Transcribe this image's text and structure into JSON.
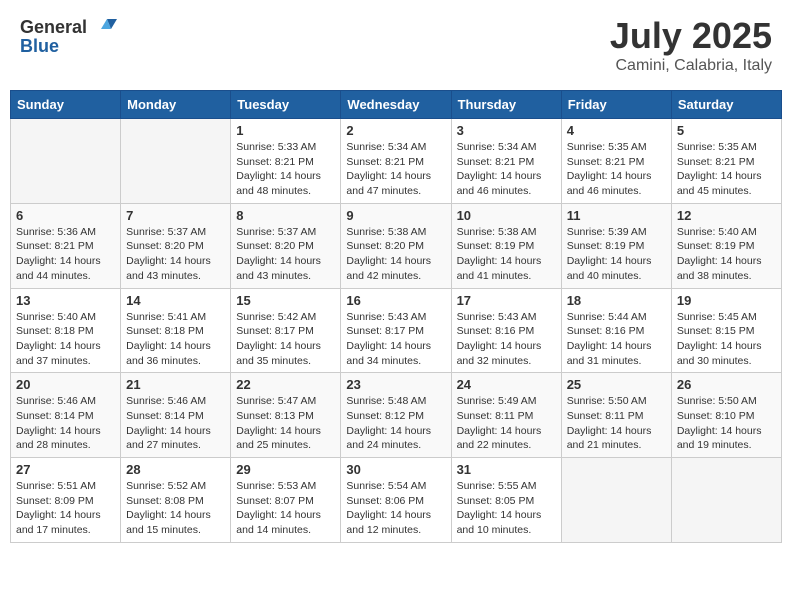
{
  "header": {
    "logo_general": "General",
    "logo_blue": "Blue",
    "month": "July 2025",
    "location": "Camini, Calabria, Italy"
  },
  "weekdays": [
    "Sunday",
    "Monday",
    "Tuesday",
    "Wednesday",
    "Thursday",
    "Friday",
    "Saturday"
  ],
  "weeks": [
    [
      {
        "day": "",
        "info": ""
      },
      {
        "day": "",
        "info": ""
      },
      {
        "day": "1",
        "info": "Sunrise: 5:33 AM\nSunset: 8:21 PM\nDaylight: 14 hours\nand 48 minutes."
      },
      {
        "day": "2",
        "info": "Sunrise: 5:34 AM\nSunset: 8:21 PM\nDaylight: 14 hours\nand 47 minutes."
      },
      {
        "day": "3",
        "info": "Sunrise: 5:34 AM\nSunset: 8:21 PM\nDaylight: 14 hours\nand 46 minutes."
      },
      {
        "day": "4",
        "info": "Sunrise: 5:35 AM\nSunset: 8:21 PM\nDaylight: 14 hours\nand 46 minutes."
      },
      {
        "day": "5",
        "info": "Sunrise: 5:35 AM\nSunset: 8:21 PM\nDaylight: 14 hours\nand 45 minutes."
      }
    ],
    [
      {
        "day": "6",
        "info": "Sunrise: 5:36 AM\nSunset: 8:21 PM\nDaylight: 14 hours\nand 44 minutes."
      },
      {
        "day": "7",
        "info": "Sunrise: 5:37 AM\nSunset: 8:20 PM\nDaylight: 14 hours\nand 43 minutes."
      },
      {
        "day": "8",
        "info": "Sunrise: 5:37 AM\nSunset: 8:20 PM\nDaylight: 14 hours\nand 43 minutes."
      },
      {
        "day": "9",
        "info": "Sunrise: 5:38 AM\nSunset: 8:20 PM\nDaylight: 14 hours\nand 42 minutes."
      },
      {
        "day": "10",
        "info": "Sunrise: 5:38 AM\nSunset: 8:19 PM\nDaylight: 14 hours\nand 41 minutes."
      },
      {
        "day": "11",
        "info": "Sunrise: 5:39 AM\nSunset: 8:19 PM\nDaylight: 14 hours\nand 40 minutes."
      },
      {
        "day": "12",
        "info": "Sunrise: 5:40 AM\nSunset: 8:19 PM\nDaylight: 14 hours\nand 38 minutes."
      }
    ],
    [
      {
        "day": "13",
        "info": "Sunrise: 5:40 AM\nSunset: 8:18 PM\nDaylight: 14 hours\nand 37 minutes."
      },
      {
        "day": "14",
        "info": "Sunrise: 5:41 AM\nSunset: 8:18 PM\nDaylight: 14 hours\nand 36 minutes."
      },
      {
        "day": "15",
        "info": "Sunrise: 5:42 AM\nSunset: 8:17 PM\nDaylight: 14 hours\nand 35 minutes."
      },
      {
        "day": "16",
        "info": "Sunrise: 5:43 AM\nSunset: 8:17 PM\nDaylight: 14 hours\nand 34 minutes."
      },
      {
        "day": "17",
        "info": "Sunrise: 5:43 AM\nSunset: 8:16 PM\nDaylight: 14 hours\nand 32 minutes."
      },
      {
        "day": "18",
        "info": "Sunrise: 5:44 AM\nSunset: 8:16 PM\nDaylight: 14 hours\nand 31 minutes."
      },
      {
        "day": "19",
        "info": "Sunrise: 5:45 AM\nSunset: 8:15 PM\nDaylight: 14 hours\nand 30 minutes."
      }
    ],
    [
      {
        "day": "20",
        "info": "Sunrise: 5:46 AM\nSunset: 8:14 PM\nDaylight: 14 hours\nand 28 minutes."
      },
      {
        "day": "21",
        "info": "Sunrise: 5:46 AM\nSunset: 8:14 PM\nDaylight: 14 hours\nand 27 minutes."
      },
      {
        "day": "22",
        "info": "Sunrise: 5:47 AM\nSunset: 8:13 PM\nDaylight: 14 hours\nand 25 minutes."
      },
      {
        "day": "23",
        "info": "Sunrise: 5:48 AM\nSunset: 8:12 PM\nDaylight: 14 hours\nand 24 minutes."
      },
      {
        "day": "24",
        "info": "Sunrise: 5:49 AM\nSunset: 8:11 PM\nDaylight: 14 hours\nand 22 minutes."
      },
      {
        "day": "25",
        "info": "Sunrise: 5:50 AM\nSunset: 8:11 PM\nDaylight: 14 hours\nand 21 minutes."
      },
      {
        "day": "26",
        "info": "Sunrise: 5:50 AM\nSunset: 8:10 PM\nDaylight: 14 hours\nand 19 minutes."
      }
    ],
    [
      {
        "day": "27",
        "info": "Sunrise: 5:51 AM\nSunset: 8:09 PM\nDaylight: 14 hours\nand 17 minutes."
      },
      {
        "day": "28",
        "info": "Sunrise: 5:52 AM\nSunset: 8:08 PM\nDaylight: 14 hours\nand 15 minutes."
      },
      {
        "day": "29",
        "info": "Sunrise: 5:53 AM\nSunset: 8:07 PM\nDaylight: 14 hours\nand 14 minutes."
      },
      {
        "day": "30",
        "info": "Sunrise: 5:54 AM\nSunset: 8:06 PM\nDaylight: 14 hours\nand 12 minutes."
      },
      {
        "day": "31",
        "info": "Sunrise: 5:55 AM\nSunset: 8:05 PM\nDaylight: 14 hours\nand 10 minutes."
      },
      {
        "day": "",
        "info": ""
      },
      {
        "day": "",
        "info": ""
      }
    ]
  ]
}
